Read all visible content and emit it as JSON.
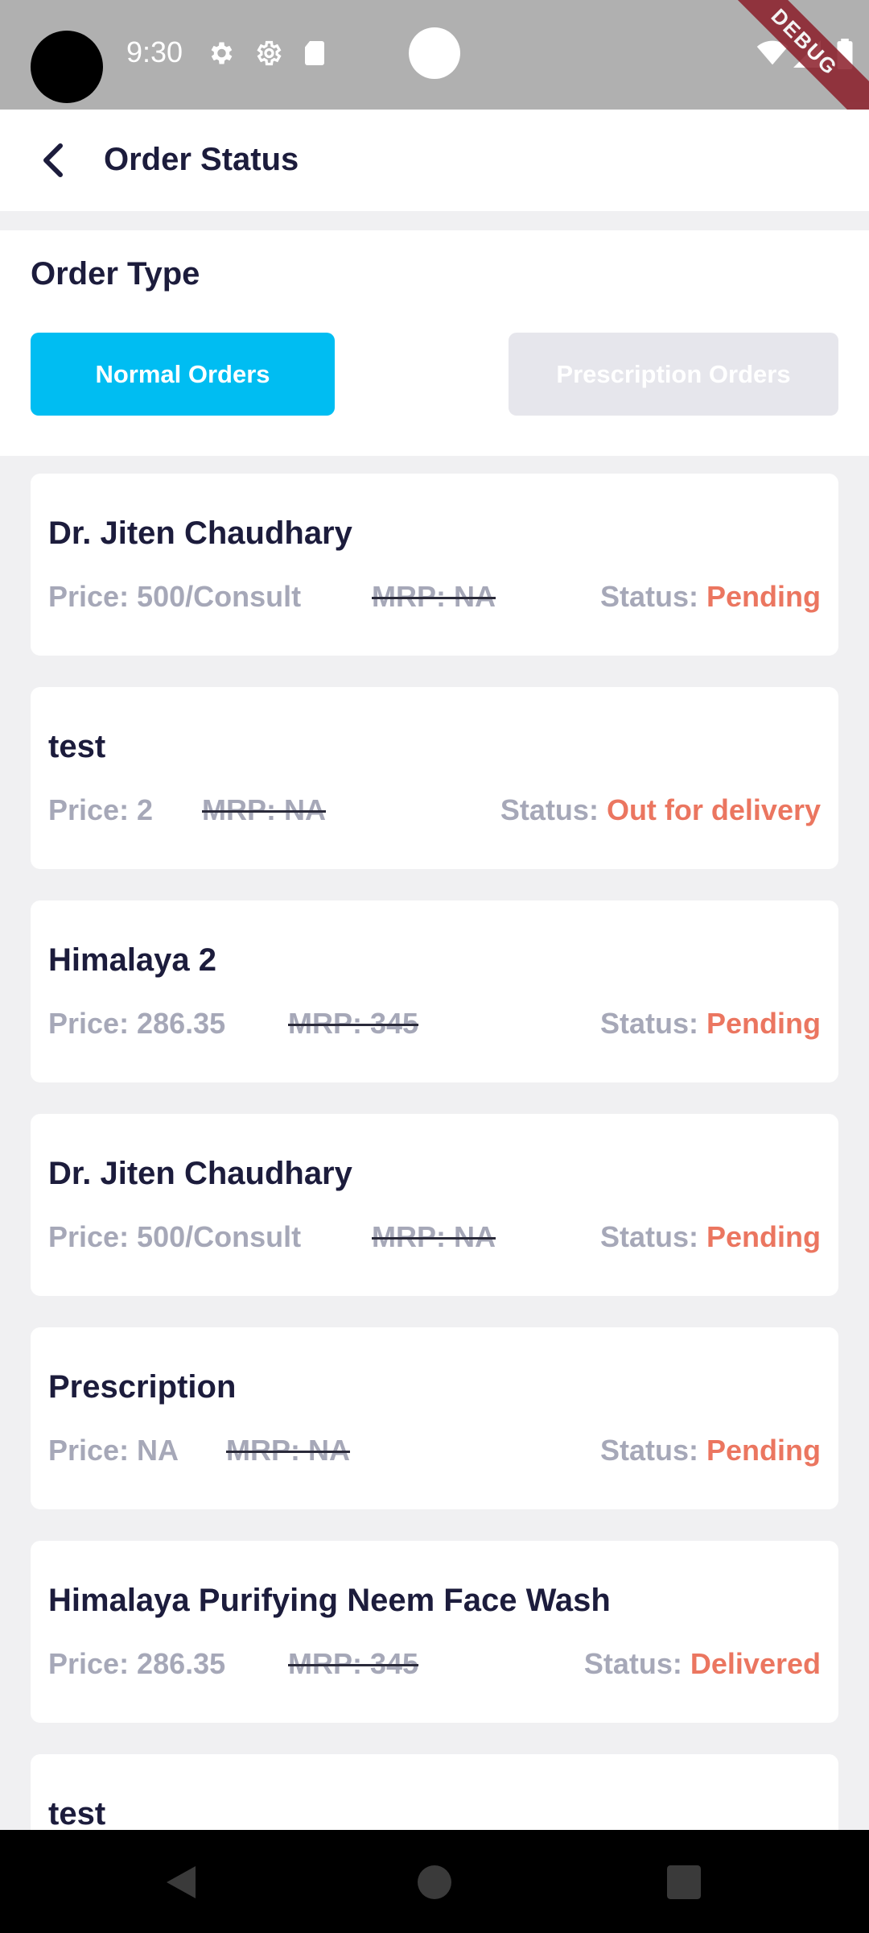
{
  "status_bar": {
    "time": "9:30",
    "debug_label": "DEBUG",
    "icons": [
      "settings-icon",
      "settings-icon",
      "sd-card-icon",
      "wifi-icon",
      "signal-icon",
      "battery-icon"
    ]
  },
  "app_bar": {
    "title": "Order Status",
    "back_icon": "back-arrow-icon"
  },
  "order_type": {
    "title": "Order Type",
    "normal_label": "Normal Orders",
    "prescription_label": "Prescription Orders",
    "selected": "Normal Orders",
    "colors": {
      "active": "#00bdf2",
      "inactive": "#e6e6ec"
    }
  },
  "orders": [
    {
      "name": "Dr. Jiten Chaudhary",
      "price": "Price: 500/Consult",
      "mrp": "MRP: NA",
      "status_label": "Status: ",
      "status": "Pending"
    },
    {
      "name": "test",
      "price": "Price: 2",
      "mrp": "MRP: NA",
      "status_label": "Status: ",
      "status": "Out for delivery"
    },
    {
      "name": "Himalaya 2",
      "price": "Price: 286.35",
      "mrp": "MRP: 345",
      "status_label": "Status: ",
      "status": "Pending"
    },
    {
      "name": "Dr. Jiten Chaudhary",
      "price": "Price: 500/Consult",
      "mrp": "MRP: NA",
      "status_label": "Status: ",
      "status": "Pending"
    },
    {
      "name": "Prescription",
      "price": "Price: NA",
      "mrp": "MRP: NA",
      "status_label": "Status: ",
      "status": "Pending"
    },
    {
      "name": "Himalaya Purifying Neem Face Wash",
      "price": "Price: 286.35",
      "mrp": "MRP: 345",
      "status_label": "Status: ",
      "status": "Delivered"
    },
    {
      "name": "test"
    }
  ],
  "colors": {
    "status": "#eb7660",
    "muted_text": "#a6a8b8",
    "title_text": "#1c1c3c"
  },
  "nav_bar": {
    "icons": [
      "nav-back-icon",
      "nav-home-icon",
      "nav-recents-icon"
    ]
  }
}
